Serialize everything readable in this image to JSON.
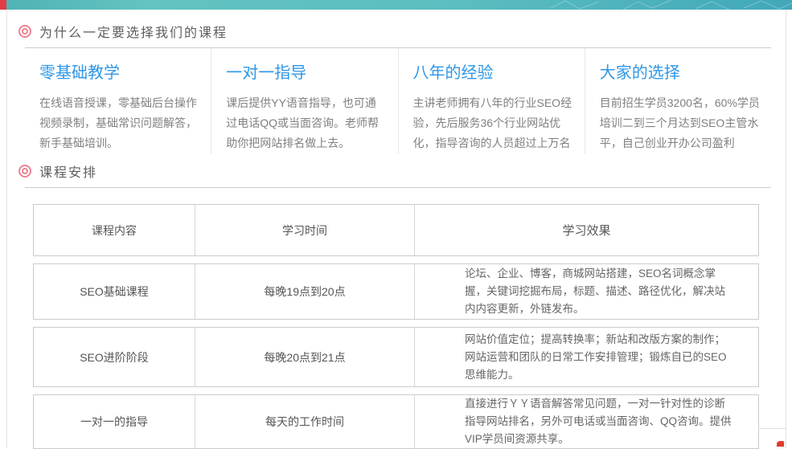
{
  "theme": {
    "topbar_teal_left": "#4fb3b3",
    "topbar_teal_right": "#41a8ba",
    "topbar_accent_red": "#e23c45",
    "section_icon_pink": "#ed8391",
    "feature_title_blue": "#2f97e6",
    "body_text_gray": "#808080",
    "table_border_gray": "#cbcbcb"
  },
  "section_why": {
    "title": "为什么一定要选择我们的课程",
    "features": [
      {
        "title": "零基础教学",
        "desc": "在线语音授课，零基础后台操作视频录制，基础常识问题解答，新手基础培训。"
      },
      {
        "title": "一对一指导",
        "desc": "课后提供YY语音指导，也可通过电话QQ或当面咨询。老师帮助你把网站排名做上去。"
      },
      {
        "title": "八年的经验",
        "desc": "主讲老师拥有八年的行业SEO经验，先后服务36个行业网站优化，指导咨询的人员超过上万名"
      },
      {
        "title": "大家的选择",
        "desc": "目前招生学员3200名，60%学员培训二到三个月达到SEO主管水平，自己创业开办公司盈利"
      }
    ]
  },
  "section_schedule": {
    "title": "课程安排",
    "table": {
      "headers": [
        "课程内容",
        "学习时间",
        "学习效果"
      ],
      "rows": [
        {
          "content": "SEO基础课程",
          "time": "每晚19点到20点",
          "effect": "论坛、企业、博客，商城网站搭建，SEO名词概念掌握，关键词挖掘布局，标题、描述、路径优化，解决站内内容更新，外链发布。"
        },
        {
          "content": "SEO进阶阶段",
          "time": "每晚20点到21点",
          "effect": "网站价值定位；提高转换率；新站和改版方案的制作；网站运营和团队的日常工作安排管理；锻炼自已的SEO思维能力。"
        },
        {
          "content": "一对一的指导",
          "time": "每天的工作时间",
          "effect": "直接进行ＹＹ语音解答常见问题，一对一针对性的诊断指导网站排名，另外可电话或当面咨询、QQ咨询。提供VIP学员间资源共享。"
        }
      ]
    }
  }
}
